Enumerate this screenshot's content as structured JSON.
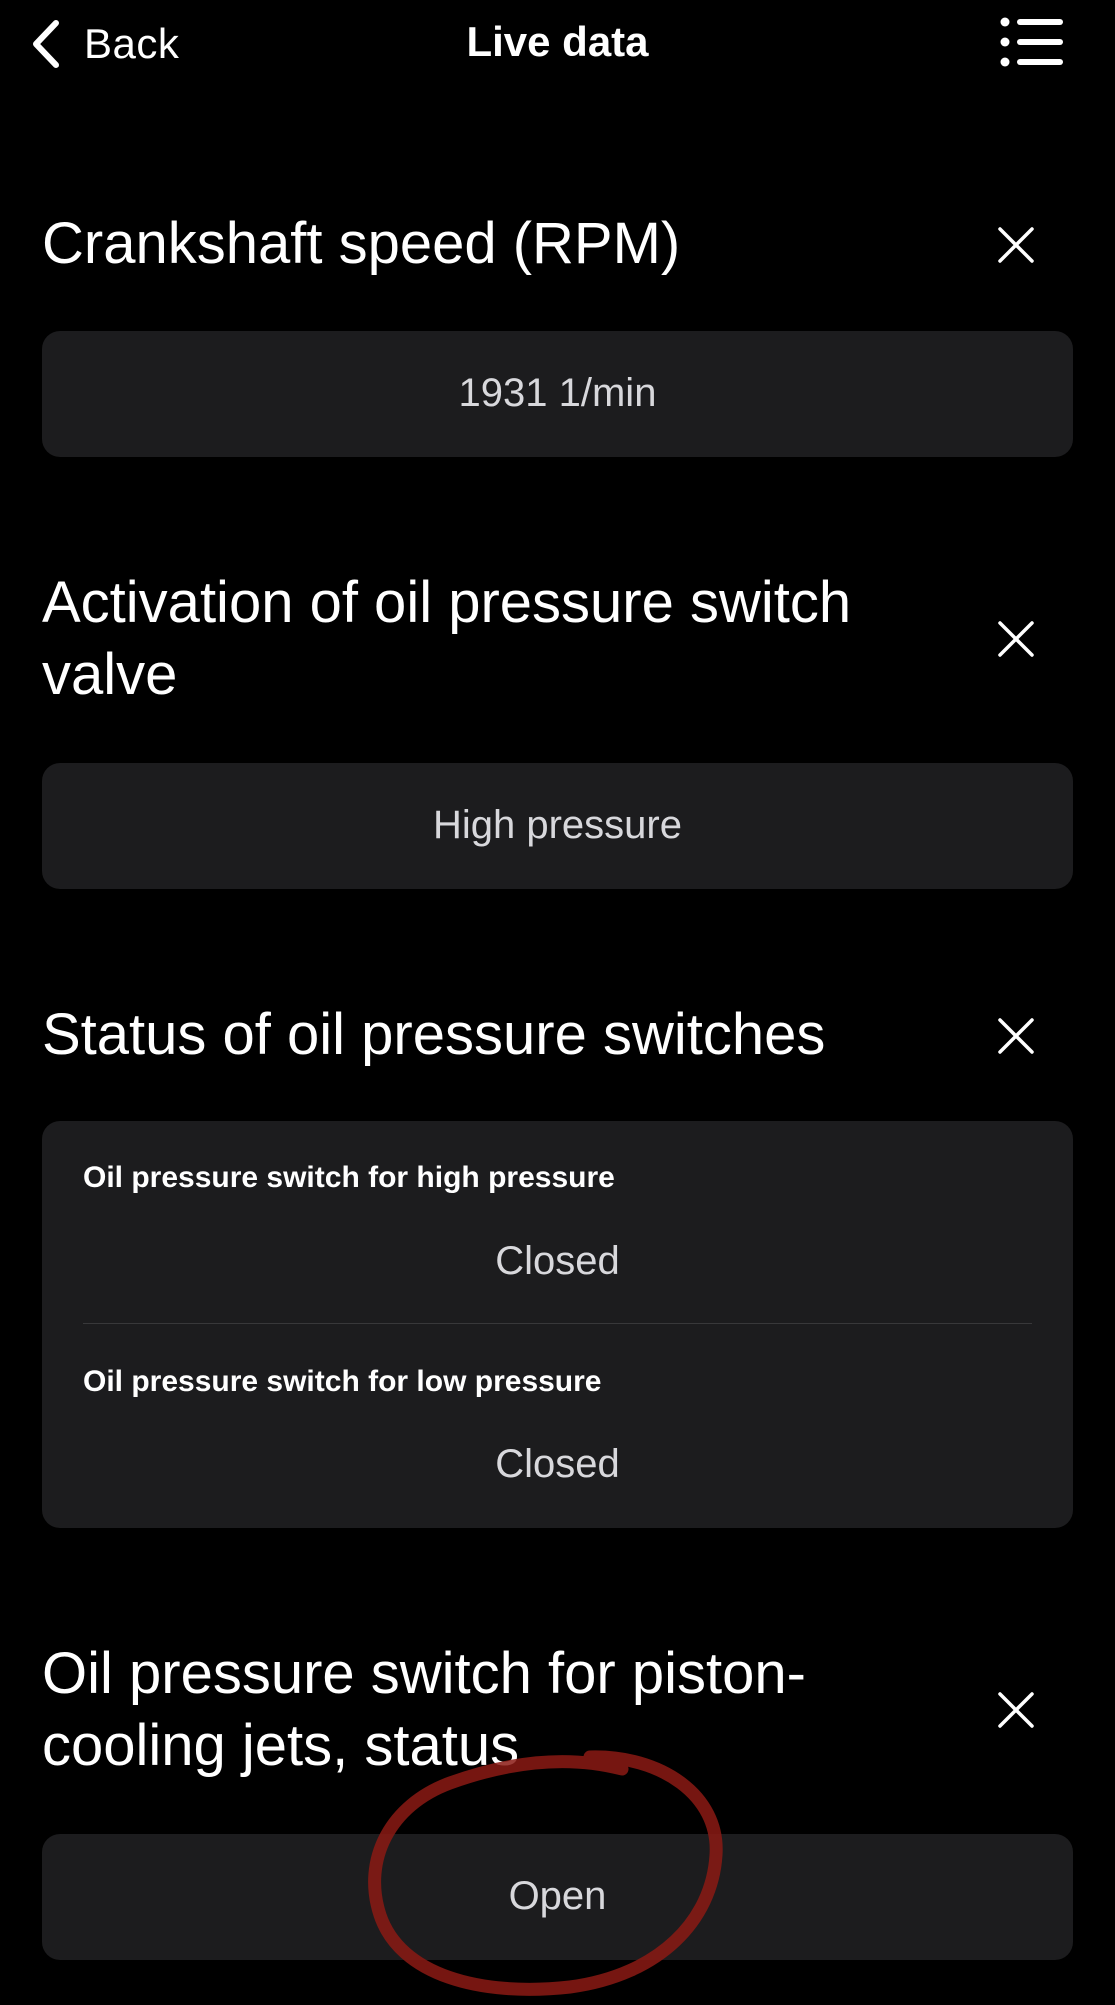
{
  "header": {
    "back_label": "Back",
    "title": "Live data"
  },
  "sections": [
    {
      "title": "Crankshaft speed (RPM)",
      "value": "1931 1/min"
    },
    {
      "title": "Activation of oil pressure switch valve",
      "value": "High pressure"
    },
    {
      "title": "Status of oil pressure switches",
      "items": [
        {
          "label": "Oil pressure switch for high pressure",
          "value": "Closed"
        },
        {
          "label": "Oil pressure switch for low pressure",
          "value": "Closed"
        }
      ]
    },
    {
      "title": "Oil pressure switch for piston-cooling jets, status",
      "value": "Open"
    }
  ],
  "colors": {
    "background": "#000000",
    "card": "#1c1c1e",
    "value_text": "#d8d8dc",
    "annotation": "#8b1a14"
  },
  "icons": {
    "back": "chevron-left-icon",
    "menu": "list-icon",
    "close": "close-icon"
  }
}
